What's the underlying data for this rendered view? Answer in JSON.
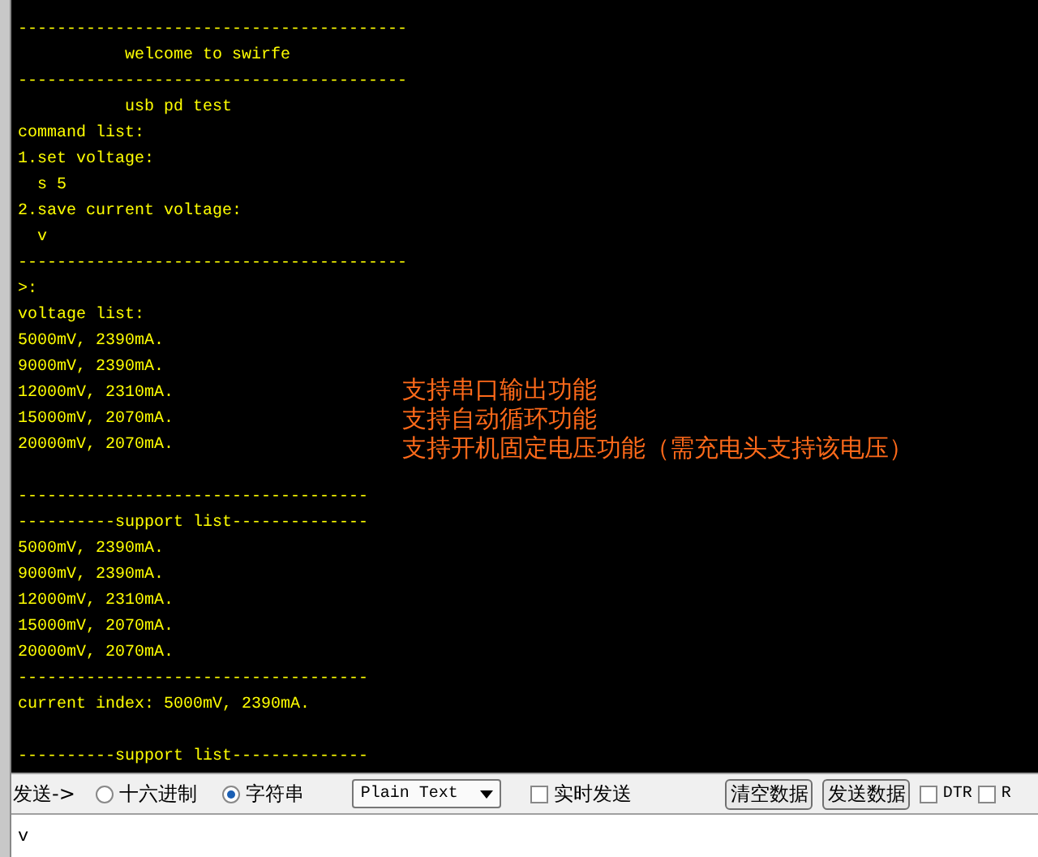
{
  "terminal": {
    "blocks": [
      {
        "lines": [
          "----------------------------------------",
          "           welcome to swirfe",
          "----------------------------------------",
          "           usb pd test",
          "command list:",
          "1.set voltage:",
          "  s 5",
          "2.save current voltage:",
          "  v",
          "----------------------------------------",
          ">:",
          "voltage list:",
          "5000mV, 2390mA.",
          "9000mV, 2390mA.",
          "12000mV, 2310mA.",
          "15000mV, 2070mA.",
          "20000mV, 2070mA."
        ]
      },
      {
        "lines": [
          "------------------------------------",
          "----------support list--------------",
          "5000mV, 2390mA.",
          "9000mV, 2390mA.",
          "12000mV, 2310mA.",
          "15000mV, 2070mA.",
          "20000mV, 2070mA.",
          "------------------------------------",
          "current index: 5000mV, 2390mA."
        ]
      },
      {
        "lines": [
          "----------support list--------------"
        ]
      }
    ]
  },
  "annotation": {
    "lines": [
      "支持串口输出功能",
      "支持自动循环功能",
      "支持开机固定电压功能（需充电头支持该电压）"
    ]
  },
  "send_bar": {
    "label": "发送->",
    "modes": [
      {
        "label": "十六进制",
        "selected": false
      },
      {
        "label": "字符串",
        "selected": true
      }
    ],
    "format": "Plain Text",
    "realtime": {
      "label": "实时发送",
      "checked": false
    },
    "buttons": [
      "清空数据",
      "发送数据"
    ],
    "flags": [
      {
        "label": "DTR",
        "checked": false
      },
      {
        "label": "R",
        "checked": false
      }
    ]
  },
  "input": {
    "value": "v"
  }
}
